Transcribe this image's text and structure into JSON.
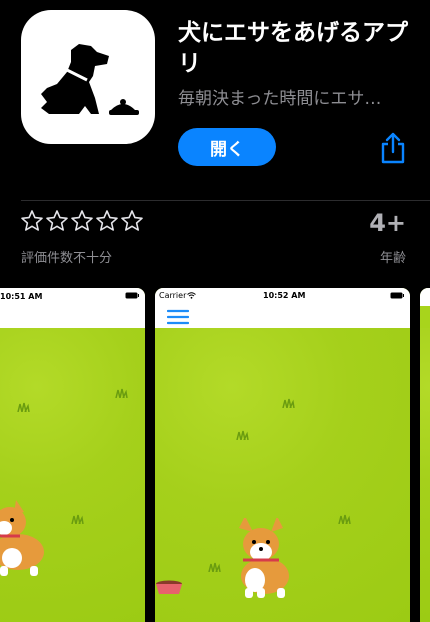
{
  "app": {
    "title": "犬にエサをあげるアプリ",
    "subtitle": "毎朝決まった時間にエサ…",
    "open_label": "開く"
  },
  "ratings": {
    "stars": [
      "☆",
      "☆",
      "☆",
      "☆",
      "☆"
    ],
    "caption": "評価件数不十分",
    "age_value": "4+",
    "age_caption": "年齢"
  },
  "screenshots": [
    {
      "time": "10:51 AM",
      "carrier": ""
    },
    {
      "time": "10:52 AM",
      "carrier": "Carrier"
    }
  ],
  "colors": {
    "background": "#000000",
    "accent": "#0a84ff",
    "secondary_text": "#8e8e93",
    "grass": "#a8d41c"
  },
  "icons": [
    "dog-silhouette-icon",
    "food-bowl-icon",
    "share-icon",
    "wifi-icon",
    "battery-icon",
    "hamburger-menu-icon",
    "corgi-image",
    "red-dog-bowl-image"
  ]
}
